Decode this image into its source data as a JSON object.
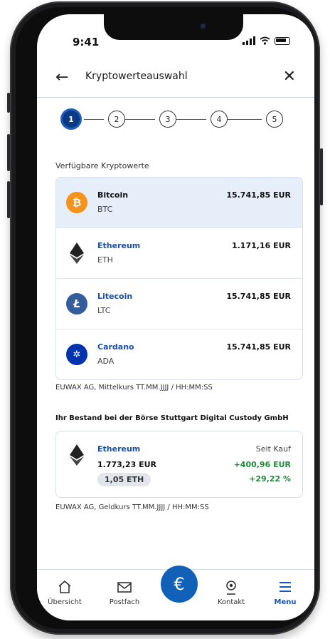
{
  "status": {
    "time": "9:41"
  },
  "header": {
    "title": "Kryptowerteauswahl"
  },
  "stepper": {
    "steps": [
      "1",
      "2",
      "3",
      "4",
      "5"
    ],
    "active": 1
  },
  "available": {
    "label": "Verfügbare Kryptowerte",
    "assets": [
      {
        "name": "Bitcoin",
        "symbol": "BTC",
        "price": "15.741,85 EUR",
        "icon": "bitcoin-icon",
        "color": "#f7931a",
        "glyph": "₿"
      },
      {
        "name": "Ethereum",
        "symbol": "ETH",
        "price": "1.171,16 EUR",
        "icon": "ethereum-icon",
        "color": "#222222",
        "glyph": "◆"
      },
      {
        "name": "Litecoin",
        "symbol": "LTC",
        "price": "15.741,85 EUR",
        "icon": "litecoin-icon",
        "color": "#345d9d",
        "glyph": "Ł"
      },
      {
        "name": "Cardano",
        "symbol": "ADA",
        "price": "15.741,85 EUR",
        "icon": "cardano-icon",
        "color": "#0033ad",
        "glyph": "✲"
      }
    ],
    "footnote": "EUWAX AG, Mittelkurs TT.MM.JJJJ / HH:MM:SS"
  },
  "holdings": {
    "title": "Ihr Bestand bei der Börse Stuttgart Digital Custody GmbH",
    "item": {
      "name": "Ethereum",
      "value": "1.773,23 EUR",
      "amount": "1,05 ETH",
      "since_label": "Seit Kauf",
      "change_abs": "+400,96 EUR",
      "change_pct": "+29,22 %"
    },
    "footnote": "EUWAX AG, Geldkurs TT.MM.JJJJ / HH:MM:SS"
  },
  "tabbar": {
    "items": [
      {
        "label": "Übersicht",
        "icon": "home-icon"
      },
      {
        "label": "Postfach",
        "icon": "mail-icon"
      },
      {
        "label": "Kontakt",
        "icon": "contact-icon"
      },
      {
        "label": "Menu",
        "icon": "menu-icon"
      }
    ],
    "fab_glyph": "€"
  },
  "colors": {
    "accent": "#1261b8",
    "positive": "#1f8a3a",
    "selected_bg": "#e6eef9"
  }
}
